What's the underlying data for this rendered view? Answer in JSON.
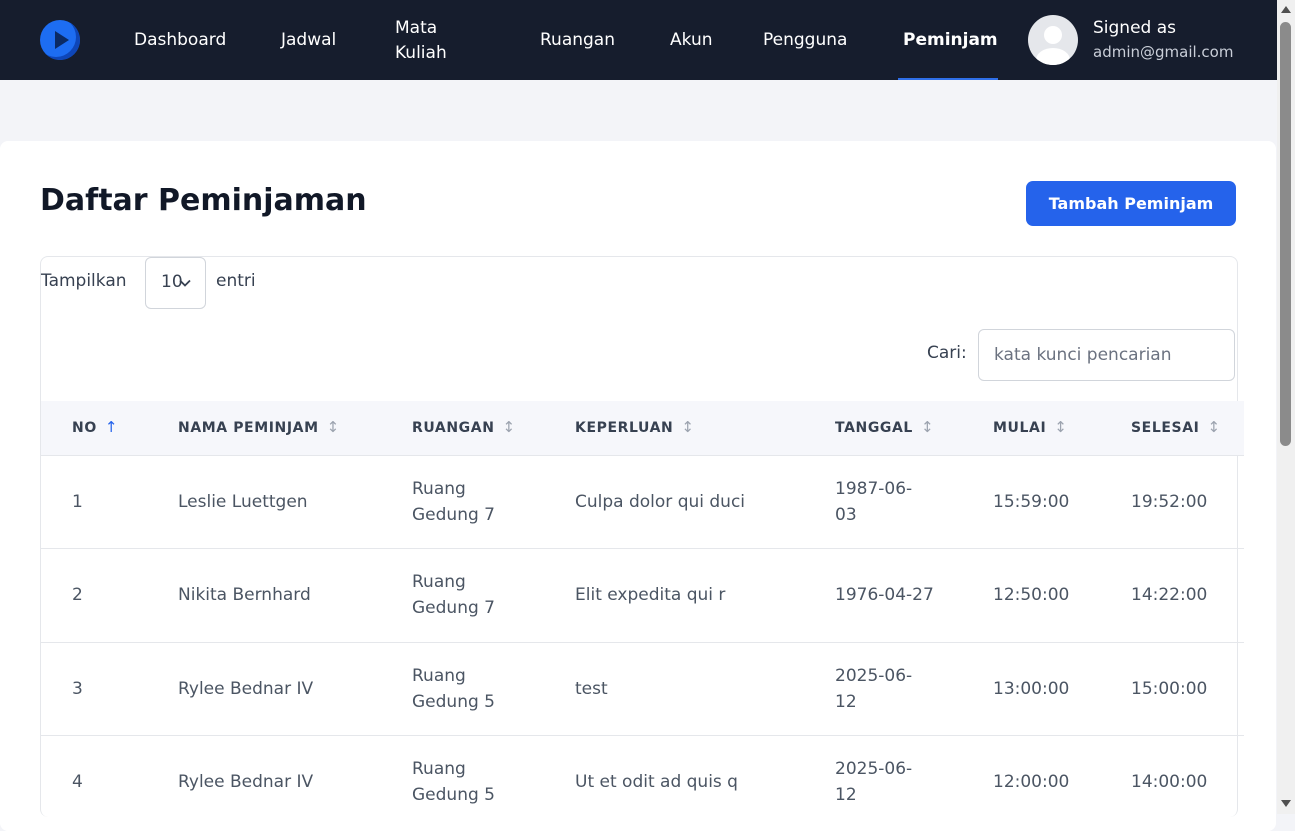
{
  "nav": {
    "items": [
      "Dashboard",
      "Jadwal",
      "Mata Kuliah",
      "Ruangan",
      "Akun",
      "Pengguna",
      "Peminjam"
    ],
    "active": "Peminjam",
    "signed_label": "Signed as",
    "signed_email": "admin@gmail.com"
  },
  "page": {
    "title": "Daftar Peminjaman",
    "add_button": "Tambah Peminjam"
  },
  "table_controls": {
    "show_label": "Tampilkan",
    "page_length": "10",
    "entries_label": "entri",
    "search_label": "Cari:",
    "search_placeholder": "kata kunci pencarian",
    "search_value": ""
  },
  "table": {
    "columns": [
      "NO",
      "NAMA PEMINJAM",
      "RUANGAN",
      "KEPERLUAN",
      "TANGGAL",
      "MULAI",
      "SELESAI"
    ],
    "sort_column": "NO",
    "sort_direction": "ascending",
    "rows": [
      {
        "no": "1",
        "nama": "Leslie Luettgen",
        "ruangan_1": "Ruang",
        "ruangan_2": "Gedung 7",
        "keperluan": "Culpa dolor qui duci",
        "tanggal_1": "1987-06-",
        "tanggal_2": "03",
        "mulai": "15:59:00",
        "selesai": "19:52:00"
      },
      {
        "no": "2",
        "nama": "Nikita Bernhard",
        "ruangan_1": "Ruang",
        "ruangan_2": "Gedung 7",
        "keperluan": "Elit expedita qui r",
        "tanggal_1": "1976-04-27",
        "tanggal_2": "",
        "mulai": "12:50:00",
        "selesai": "14:22:00"
      },
      {
        "no": "3",
        "nama": "Rylee Bednar IV",
        "ruangan_1": "Ruang",
        "ruangan_2": "Gedung 5",
        "keperluan": "test",
        "tanggal_1": "2025-06-",
        "tanggal_2": "12",
        "mulai": "13:00:00",
        "selesai": "15:00:00"
      },
      {
        "no": "4",
        "nama": "Rylee Bednar IV",
        "ruangan_1": "Ruang",
        "ruangan_2": "Gedung 5",
        "keperluan": "Ut et odit ad quis q",
        "tanggal_1": "2025-06-",
        "tanggal_2": "12",
        "mulai": "12:00:00",
        "selesai": "14:00:00"
      }
    ]
  },
  "icons": {
    "logo": "play-logo-icon",
    "avatar": "user-avatar-icon",
    "sort_neutral": "sort-icon",
    "sort_asc": "sort-ascending-icon",
    "select": "chevron-down-icon"
  },
  "colors": {
    "topbar": "#161d2d",
    "primary": "#2563eb",
    "page_bg": "#f3f4f8"
  }
}
